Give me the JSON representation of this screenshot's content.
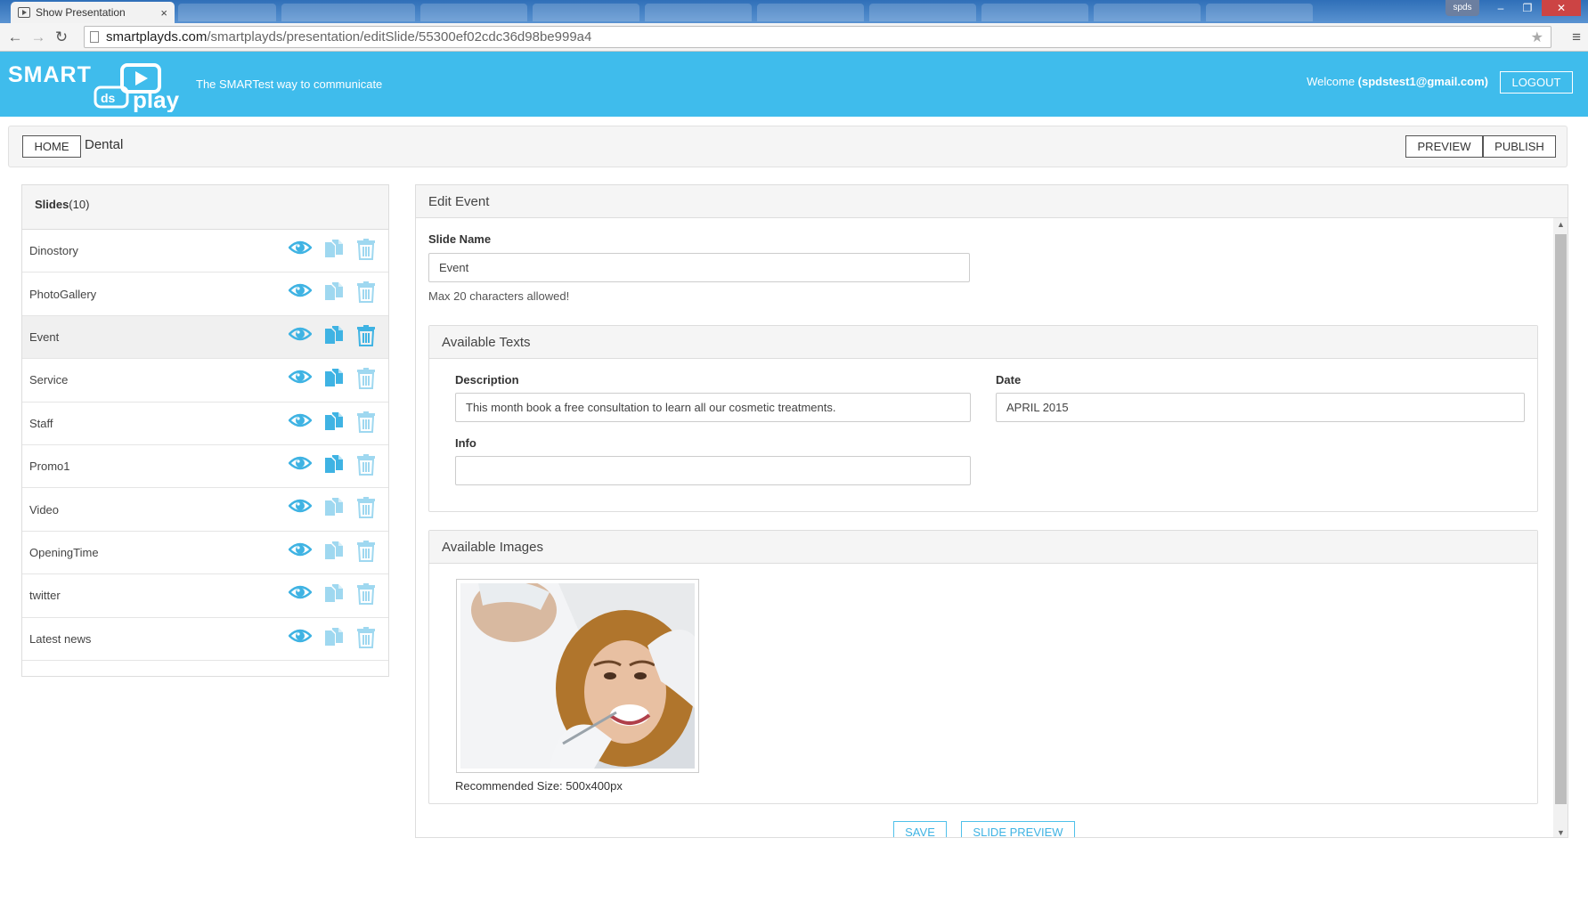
{
  "browser": {
    "tab_title": "Show Presentation",
    "tab_close": "×",
    "url_host": "smartplayds.com",
    "url_path": "/smartplayds/presentation/editSlide/55300ef02cdc36d98be999a4",
    "profile_name": "spds",
    "win_minimize": "–",
    "win_restore": "❐",
    "win_close": "✕",
    "back": "←",
    "forward": "→",
    "reload": "↻",
    "bookmark": "★",
    "menu": "≡"
  },
  "header": {
    "logo_word_top": "SMART",
    "logo_word_ds": "ds",
    "logo_word_bottom": "play",
    "tagline": "The SMARTest way to communicate",
    "welcome_prefix": "Welcome ",
    "welcome_user": "(spdstest1@gmail.com)",
    "logout_label": "LOGOUT"
  },
  "toolbar": {
    "home_label": "HOME",
    "breadcrumb": "Dental",
    "preview_label": "PREVIEW",
    "publish_label": "PUBLISH"
  },
  "slides": {
    "title": "Slides",
    "count": "(10)",
    "items": [
      {
        "label": "Dinostory"
      },
      {
        "label": "PhotoGallery"
      },
      {
        "label": "Event"
      },
      {
        "label": "Service"
      },
      {
        "label": "Staff"
      },
      {
        "label": "Promo1"
      },
      {
        "label": "Video"
      },
      {
        "label": "OpeningTime"
      },
      {
        "label": "twitter"
      },
      {
        "label": "Latest news"
      }
    ],
    "active_index": 2
  },
  "edit": {
    "title": "Edit Event",
    "slide_name_label": "Slide Name",
    "slide_name_value": "Event",
    "slide_name_hint": "Max 20 characters allowed!",
    "texts_title": "Available Texts",
    "description_label": "Description",
    "description_value": "This month book a free consultation to learn all our cosmetic treatments.",
    "date_label": "Date",
    "date_value": "APRIL 2015",
    "info_label": "Info",
    "info_value": "",
    "images_title": "Available Images",
    "recommended_size": "Recommended Size: 500x400px",
    "save_label": "SAVE",
    "slide_preview_label": "SLIDE PREVIEW"
  },
  "colors": {
    "brand_blue": "#3fbcec",
    "icon_blue": "#3fb3e3",
    "icon_blue_light": "#9fd8f0"
  },
  "icons": [
    "eye-icon",
    "copy-icon",
    "trash-icon"
  ]
}
